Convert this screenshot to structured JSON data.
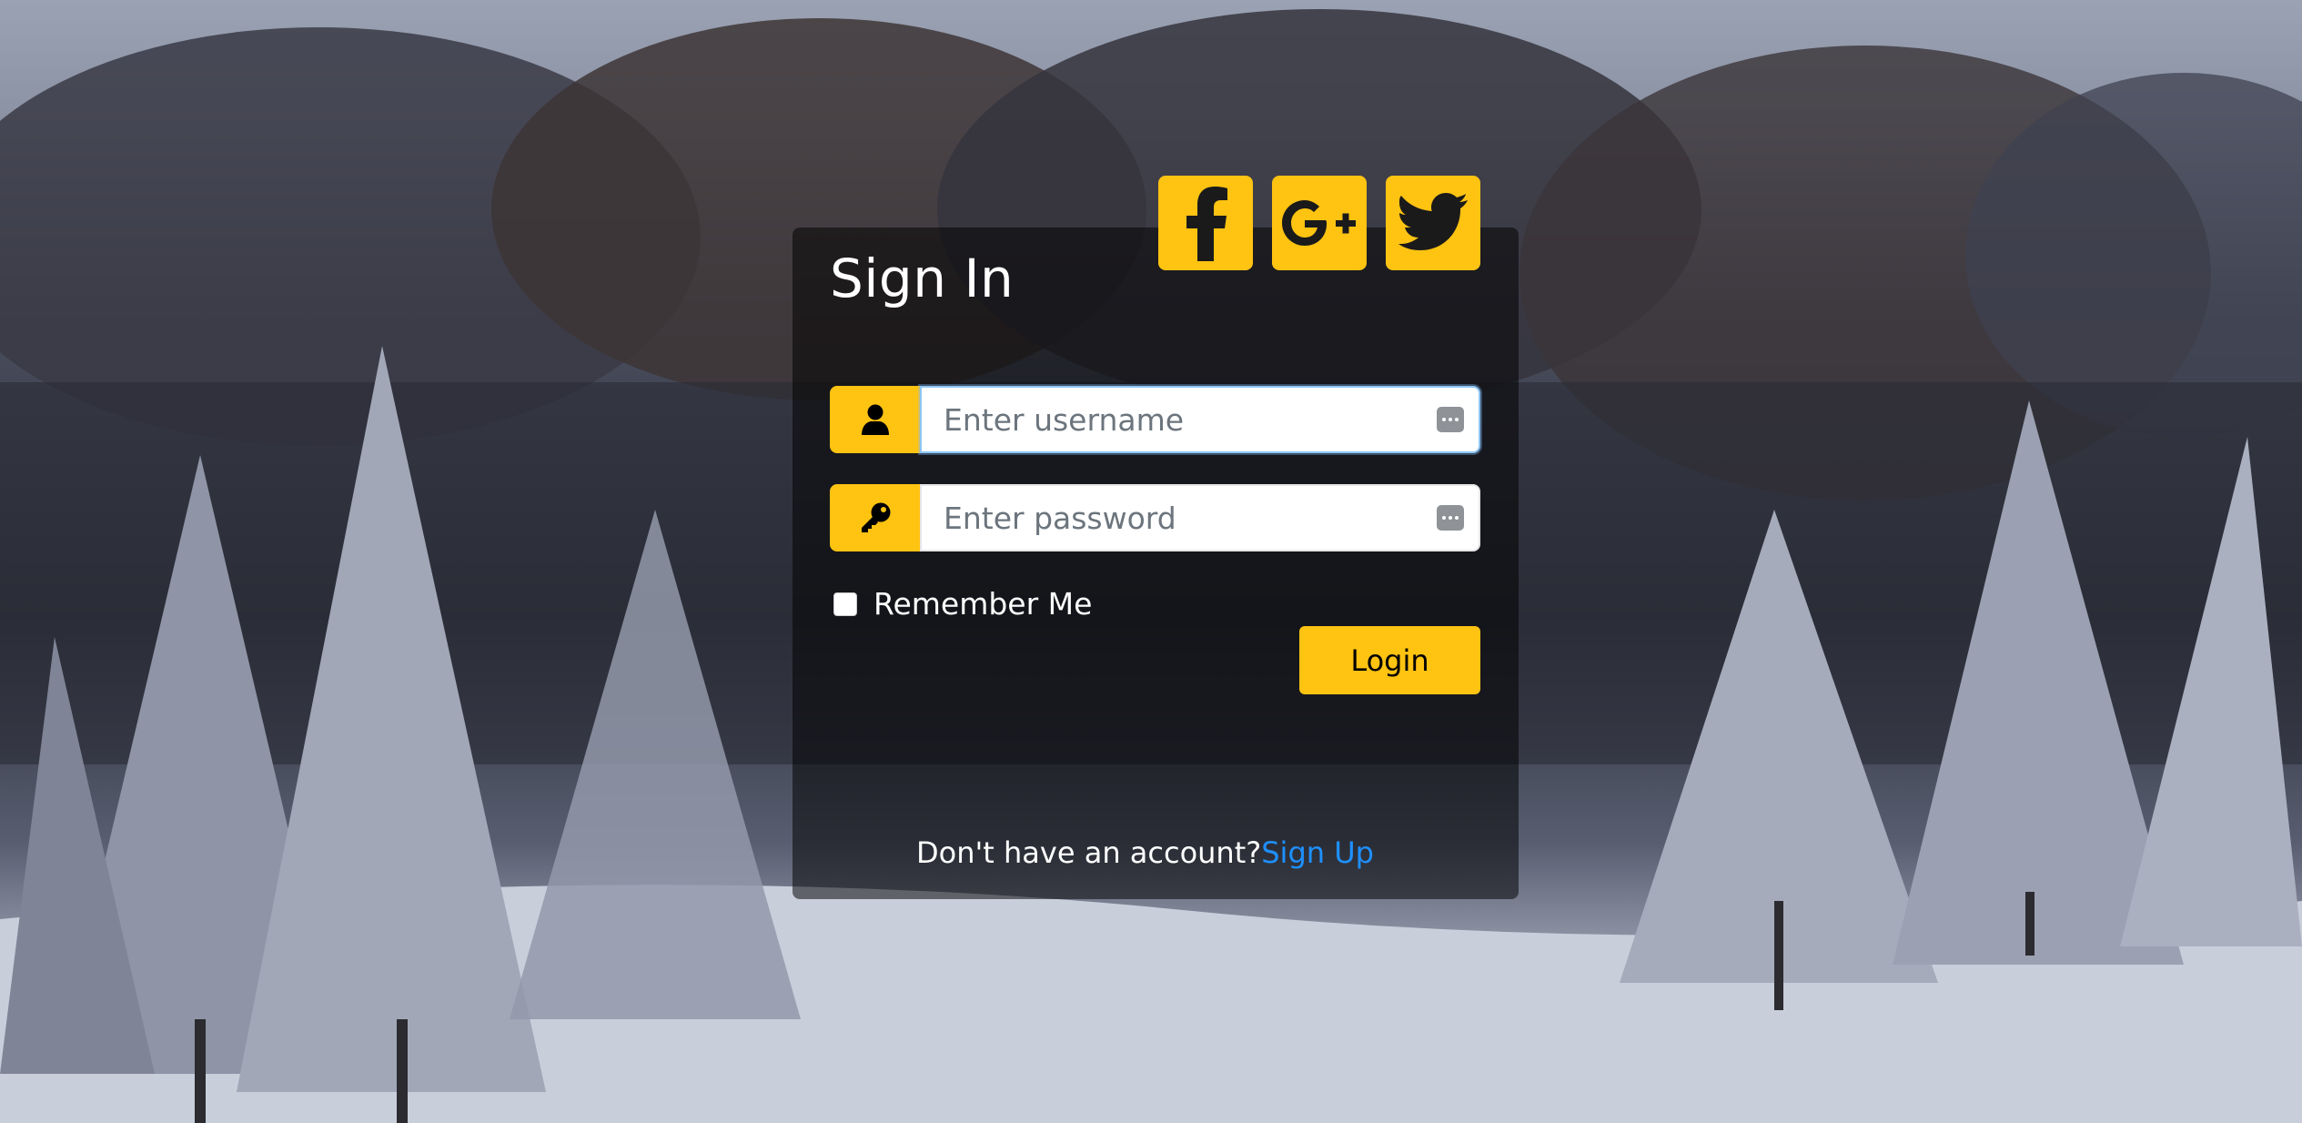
{
  "page": {
    "title": "Sign In"
  },
  "social": [
    {
      "name": "facebook",
      "icon": "facebook-icon"
    },
    {
      "name": "google-plus",
      "icon": "google-plus-icon"
    },
    {
      "name": "twitter",
      "icon": "twitter-icon"
    }
  ],
  "form": {
    "username": {
      "placeholder": "Enter username",
      "value": "",
      "icon": "user-icon"
    },
    "password": {
      "placeholder": "Enter password",
      "value": "",
      "icon": "key-icon"
    },
    "remember_label": "Remember Me",
    "remember_checked": false,
    "login_label": "Login"
  },
  "footer": {
    "prompt": "Don't have an account?",
    "signup_label": "Sign Up"
  },
  "colors": {
    "accent": "#ffc312",
    "link": "#1e90ff",
    "card_bg": "rgba(0,0,0,0.52)"
  }
}
